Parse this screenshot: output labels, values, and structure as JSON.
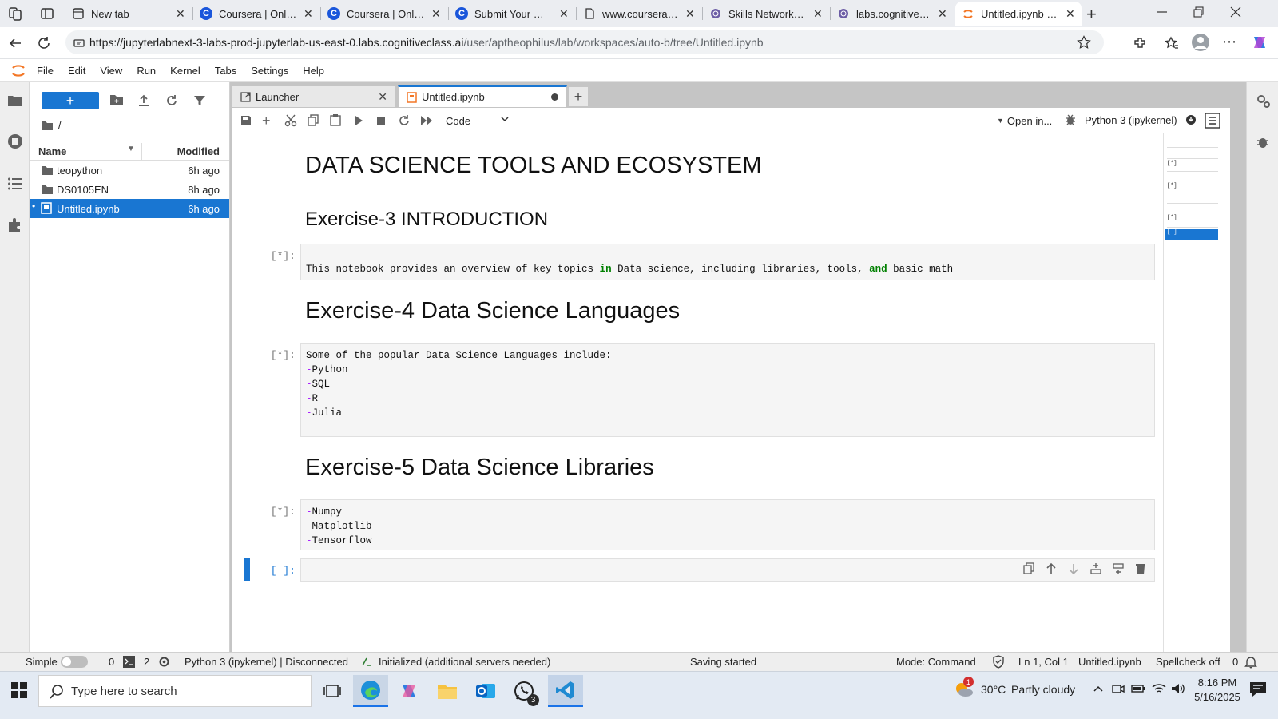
{
  "browser": {
    "tabs": [
      {
        "title": "New tab",
        "icon": "page-icon",
        "active": false
      },
      {
        "title": "Coursera | Online C",
        "icon": "coursera-icon",
        "active": false
      },
      {
        "title": "Coursera | Online C",
        "icon": "coursera-icon",
        "active": false
      },
      {
        "title": "Submit Your Work",
        "icon": "coursera-icon",
        "active": false
      },
      {
        "title": "www.coursera.org",
        "icon": "page-icon",
        "active": false
      },
      {
        "title": "Skills Network Edit",
        "icon": "globe-icon",
        "active": false
      },
      {
        "title": "labs.cognitiveclass.",
        "icon": "globe-icon",
        "active": false
      },
      {
        "title": "Untitled.ipynb (aut",
        "icon": "jupyter-icon",
        "active": true
      }
    ],
    "url_host": "https://jupyterlabnext-3-labs-prod-jupyterlab-us-east-0.labs.cognitiveclass.ai",
    "url_path": "/user/aptheophilus/lab/workspaces/auto-b/tree/Untitled.ipynb"
  },
  "menubar": [
    "File",
    "Edit",
    "View",
    "Run",
    "Kernel",
    "Tabs",
    "Settings",
    "Help"
  ],
  "filebrowser": {
    "new_label": "+",
    "path": "/",
    "col_name": "Name",
    "col_modified": "Modified",
    "items": [
      {
        "name": "teopython",
        "modified": "6h ago",
        "type": "folder",
        "selected": false
      },
      {
        "name": "DS0105EN",
        "modified": "8h ago",
        "type": "folder",
        "selected": false
      },
      {
        "name": "Untitled.ipynb",
        "modified": "6h ago",
        "type": "notebook",
        "selected": true
      }
    ]
  },
  "doc_tabs": [
    {
      "label": "Launcher"
    },
    {
      "label": "Untitled.ipynb"
    }
  ],
  "nb_toolbar": {
    "cell_type": "Code",
    "open_in": "Open in...",
    "kernel": "Python 3 (ipykernel)"
  },
  "notebook": {
    "h1": "DATA SCIENCE TOOLS AND ECOSYSTEM",
    "h2_intro": "Exercise-3 INTRODUCTION",
    "cell1_prompt": "[*]:",
    "cell1_a": "This notebook provides an overview of key topics ",
    "cell1_kw1": "in",
    "cell1_b": " Data science, including libraries, tools, ",
    "cell1_kw2": "and",
    "cell1_c": " basic math",
    "h_lang": "Exercise-4 Data Science Languages",
    "cell2_prompt": "[*]:",
    "cell2_intro": "Some of the popular Data Science Languages include:",
    "languages": [
      "Python",
      "SQL",
      "R",
      "Julia"
    ],
    "h_libs": "Exercise-5 Data Science Libraries",
    "cell3_prompt": "[*]:",
    "libraries": [
      "Numpy",
      "Matplotlib",
      "Tensorflow"
    ],
    "cell4_prompt": "[ ]:"
  },
  "minimap": {
    "cell1_prompt": "[*]",
    "cell2_prompt": "[*]",
    "cell3_prompt": "[*]",
    "cell4_prompt": "[ ]"
  },
  "statusbar": {
    "mode_label": "Simple",
    "terminals": "0",
    "kernels": "2",
    "kernel_status": "Python 3 (ipykernel) | Disconnected",
    "init": "Initialized (additional servers needed)",
    "saving": "Saving started",
    "mode": "Mode: Command",
    "position": "Ln 1, Col 1",
    "file": "Untitled.ipynb",
    "spellcheck": "Spellcheck off",
    "notifications": "0"
  },
  "taskbar": {
    "search_placeholder": "Type here to search",
    "weather": "30°C",
    "weather_desc": "Partly cloudy",
    "time": "8:16 PM",
    "date": "5/16/2025",
    "whatsapp_badge": "3",
    "alert_badge": "1"
  },
  "colors": {
    "accent": "#1976d2",
    "kernel_busy": "#555555"
  }
}
